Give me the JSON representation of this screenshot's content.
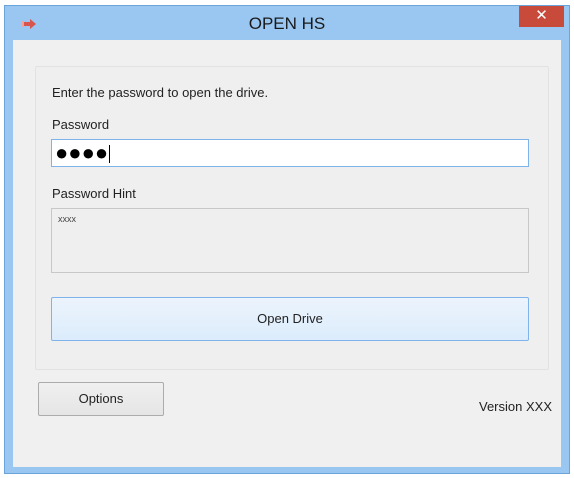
{
  "window": {
    "title": "OPEN HS",
    "close_label": "✕",
    "app_icon": "arrow-right-icon",
    "colors": {
      "titlebar": "#99c7f1",
      "close": "#c74a3a",
      "client": "#f0f0f0",
      "focus_border": "#7eb4ea"
    }
  },
  "form": {
    "instruction": "Enter the password to open the drive.",
    "password_label": "Password",
    "password_value": "●●●●",
    "hint_label": "Password Hint",
    "hint_value": "xxxx",
    "open_button": "Open Drive"
  },
  "footer": {
    "options_button": "Options",
    "version": "Version XXX"
  }
}
